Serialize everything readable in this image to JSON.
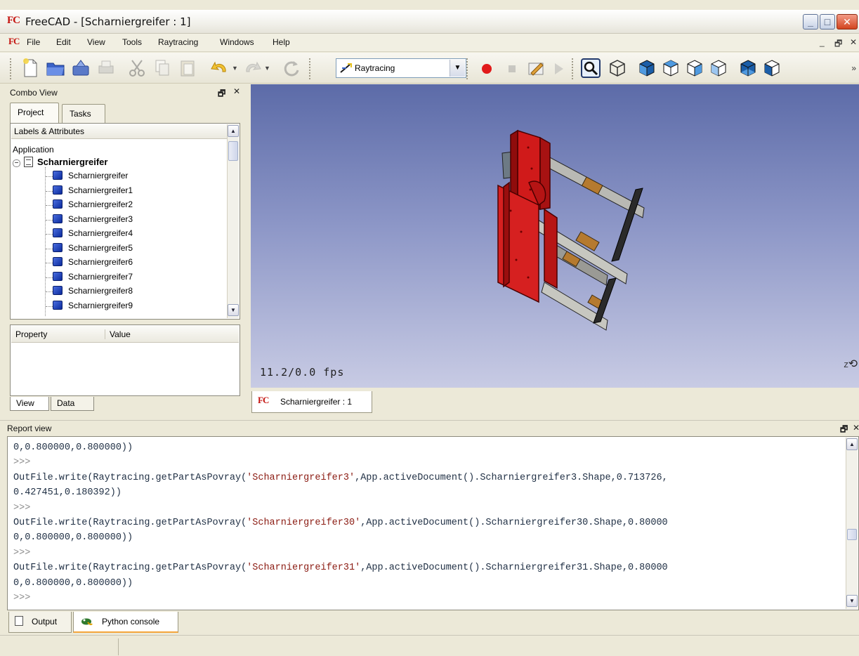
{
  "window": {
    "app_logo": "FC",
    "title": "FreeCAD - [Scharniergreifer : 1]"
  },
  "menu": {
    "items": [
      "File",
      "Edit",
      "View",
      "Tools",
      "Raytracing",
      "Windows",
      "Help"
    ],
    "mdi_controls": [
      "_",
      "🗗",
      "✕"
    ]
  },
  "toolbar": {
    "workbench": "Raytracing"
  },
  "combo_view": {
    "title": "Combo View",
    "tabs": [
      "Project",
      "Tasks"
    ],
    "tree_header": "Labels & Attributes",
    "root": "Application",
    "document": "Scharniergreifer",
    "objects": [
      "Scharniergreifer",
      "Scharniergreifer1",
      "Scharniergreifer2",
      "Scharniergreifer3",
      "Scharniergreifer4",
      "Scharniergreifer5",
      "Scharniergreifer6",
      "Scharniergreifer7",
      "Scharniergreifer8",
      "Scharniergreifer9"
    ],
    "property_headers": [
      "Property",
      "Value"
    ],
    "bottom_tabs": [
      "View",
      "Data"
    ]
  },
  "view3d": {
    "fps": "11.2/0.0 fps",
    "tab_label": "Scharniergreifer : 1",
    "axis": "Z"
  },
  "report": {
    "title": "Report view",
    "lines": [
      {
        "text": "0,0.800000,0.800000))",
        "kind": "code"
      },
      {
        "text": ">>>",
        "kind": "prompt"
      },
      {
        "pre": "OutFile.write(Raytracing.getPartAsPovray(",
        "str": "'Scharniergreifer3'",
        "post": ",App.activeDocument().Scharniergreifer3.Shape,0.713726,",
        "kind": "mixed"
      },
      {
        "text": "0.427451,0.180392))",
        "kind": "code"
      },
      {
        "text": ">>>",
        "kind": "prompt"
      },
      {
        "pre": "OutFile.write(Raytracing.getPartAsPovray(",
        "str": "'Scharniergreifer30'",
        "post": ",App.activeDocument().Scharniergreifer30.Shape,0.80000",
        "kind": "mixed"
      },
      {
        "text": "0,0.800000,0.800000))",
        "kind": "code"
      },
      {
        "text": ">>>",
        "kind": "prompt"
      },
      {
        "pre": "OutFile.write(Raytracing.getPartAsPovray(",
        "str": "'Scharniergreifer31'",
        "post": ",App.activeDocument().Scharniergreifer31.Shape,0.80000",
        "kind": "mixed"
      },
      {
        "text": "0,0.800000,0.800000))",
        "kind": "code"
      },
      {
        "text": ">>>",
        "kind": "prompt"
      }
    ],
    "tabs": [
      "Output",
      "Python console"
    ]
  },
  "colors": {
    "accent": "#c4130f",
    "part_blue": "#1a3fc4",
    "view_top": "#5c6ba8",
    "view_bottom": "#c8cbe4"
  }
}
